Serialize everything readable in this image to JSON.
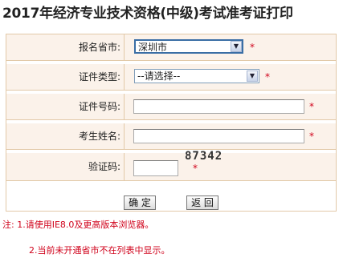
{
  "page": {
    "title": "2017年经济专业技术资格(中级)考试准考证打印"
  },
  "form": {
    "province": {
      "label": "报名省市:",
      "selected": "深圳市"
    },
    "doc_type": {
      "label": "证件类型:",
      "selected": "--请选择--"
    },
    "doc_number": {
      "label": "证件号码:",
      "value": ""
    },
    "name": {
      "label": "考生姓名:",
      "value": ""
    },
    "captcha": {
      "label": "验证码:",
      "value": "",
      "image_text": "87342"
    },
    "required_mark": "*"
  },
  "buttons": {
    "confirm_label": "确 定",
    "back_label": "返 回"
  },
  "notes": {
    "line1": "注: 1.请使用IE8.0及更高版本浏览器。",
    "line2": "2.当前未开通省市不在列表中显示。"
  },
  "colors": {
    "accent_red": "#d0021b",
    "row_bg": "#fbf2ea",
    "border": "#e2c9a8"
  },
  "icons": {
    "dropdown": "chevron-down-icon"
  }
}
